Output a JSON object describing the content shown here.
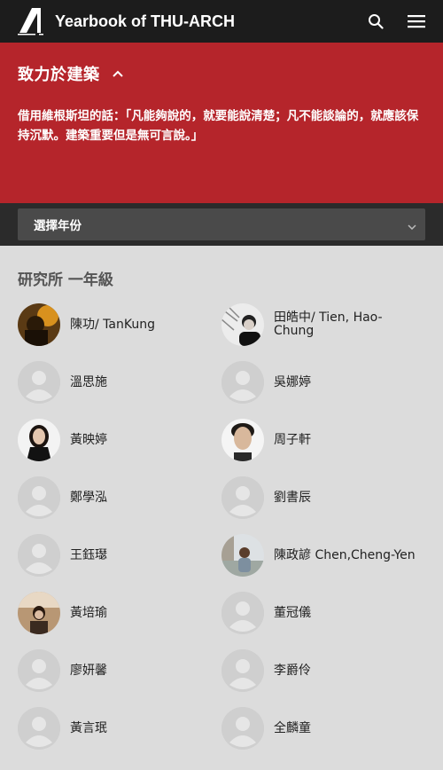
{
  "header": {
    "site_title": "Yearbook of THU-ARCH",
    "logo_icon": "thu-arch-logo"
  },
  "hero": {
    "title": "致力於建築",
    "quote": "借用維根斯坦的話：「凡能夠說的，就要能說清楚；凡不能談論的，就應該保持沉默。建築重要但是無可言說。」"
  },
  "year_select": {
    "label": "選擇年份"
  },
  "section": {
    "title": "研究所 一年級",
    "people": [
      {
        "name": "陳功/ TanKung",
        "avatar": "photo-dark"
      },
      {
        "name": "田皓中/ Tien, Hao-Chung",
        "avatar": "photo-bw"
      },
      {
        "name": "溫思施",
        "avatar": "default"
      },
      {
        "name": "吳娜婷",
        "avatar": "default"
      },
      {
        "name": "黃映婷",
        "avatar": "photo-woman"
      },
      {
        "name": "周子軒",
        "avatar": "photo-man"
      },
      {
        "name": "鄭學泓",
        "avatar": "default"
      },
      {
        "name": "劉書辰",
        "avatar": "default"
      },
      {
        "name": "王鈺璱",
        "avatar": "default"
      },
      {
        "name": "陳政諺 Chen,Cheng-Yen",
        "avatar": "photo-outdoor"
      },
      {
        "name": "黃培瑜",
        "avatar": "photo-room"
      },
      {
        "name": "董冠儀",
        "avatar": "default"
      },
      {
        "name": "廖妍馨",
        "avatar": "default"
      },
      {
        "name": "李爵伶",
        "avatar": "default"
      },
      {
        "name": "黃言珉",
        "avatar": "default"
      },
      {
        "name": "全麟童",
        "avatar": "default"
      }
    ]
  }
}
